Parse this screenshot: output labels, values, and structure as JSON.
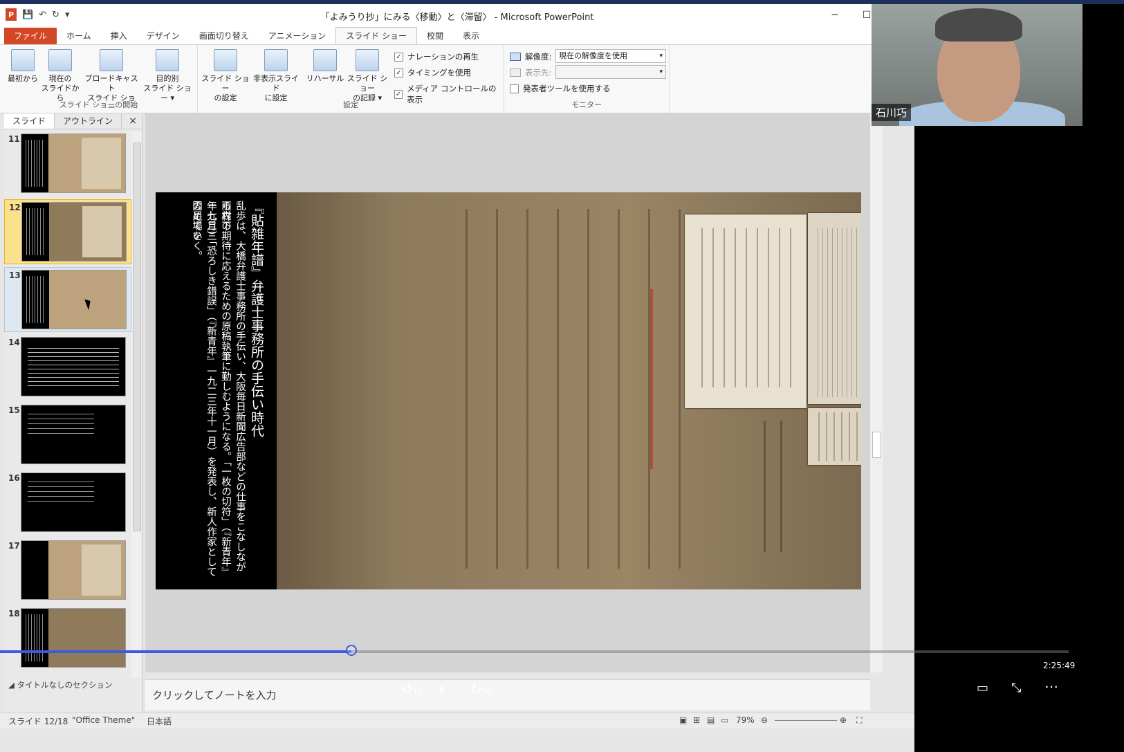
{
  "window": {
    "title": "「よみうり抄」にみる〈移動〉と〈滞留〉 - Microsoft PowerPoint",
    "app_letter": "P",
    "minimize": "─",
    "maximize": "☐",
    "close": "✕"
  },
  "tabs": [
    {
      "label": "ファイル"
    },
    {
      "label": "ホーム"
    },
    {
      "label": "挿入"
    },
    {
      "label": "デザイン"
    },
    {
      "label": "画面切り替え"
    },
    {
      "label": "アニメーション"
    },
    {
      "label": "スライド ショー"
    },
    {
      "label": "校閲"
    },
    {
      "label": "表示"
    }
  ],
  "ribbon": {
    "group_start": {
      "label": "スライド ショーの開始",
      "btn_from_start": "最初から",
      "btn_from_current_1": "現在の",
      "btn_from_current_2": "スライドから",
      "btn_broadcast_1": "ブロードキャスト",
      "btn_broadcast_2": "スライド ショー",
      "btn_custom_1": "目的別",
      "btn_custom_2": "スライド ショー ▾"
    },
    "group_setup": {
      "label": "設定",
      "btn_setup_1": "スライド ショー",
      "btn_setup_2": "の設定",
      "btn_hide_1": "非表示スライド",
      "btn_hide_2": "に設定",
      "btn_rehearse": "リハーサル",
      "btn_record_1": "スライド ショー",
      "btn_record_2": "の記録 ▾",
      "chk_narration": "ナレーションの再生",
      "chk_timing": "タイミングを使用",
      "chk_media": "メディア コントロールの表示"
    },
    "group_monitor": {
      "label": "モニター",
      "resolution_label": "解像度:",
      "resolution_value": "現在の解像度を使用",
      "show_on_label": "表示先:",
      "presenter_view": "発表者ツールを使用する"
    }
  },
  "pane": {
    "tab_slides": "スライド",
    "tab_outline": "アウトライン",
    "close": "×",
    "slide_numbers": [
      "11",
      "12",
      "13",
      "14",
      "15",
      "16",
      "17",
      "18"
    ],
    "section_label": "タイトルなしのセクション"
  },
  "slide": {
    "title": "『貼雑年譜』弁護士事務所の手伝い時代",
    "body1": "乱歩は、大橋弁護士事務所の手伝い、大阪毎日新聞広告部などの仕事をこなしながら森下",
    "body2": "雨村の期待に応えるための原稿執筆に勤しむようになる。「一枚の切符」（『新青年』一九二三",
    "body3": "年七月）「恐ろしき錯誤」（『新青年』一九二三年十一月）を発表し、新人作家としての足場を",
    "body4": "固めていく。"
  },
  "notes": {
    "placeholder": "クリックしてノートを入力"
  },
  "status": {
    "slide": "スライド 12/18",
    "theme": "\"Office Theme\"",
    "language": "日本語",
    "zoom": "79%"
  },
  "webcam": {
    "name": "石川巧"
  },
  "player": {
    "progress_fraction": 0.329,
    "time": "2:25:49",
    "rewind_label": "10",
    "forward_label": "30"
  }
}
